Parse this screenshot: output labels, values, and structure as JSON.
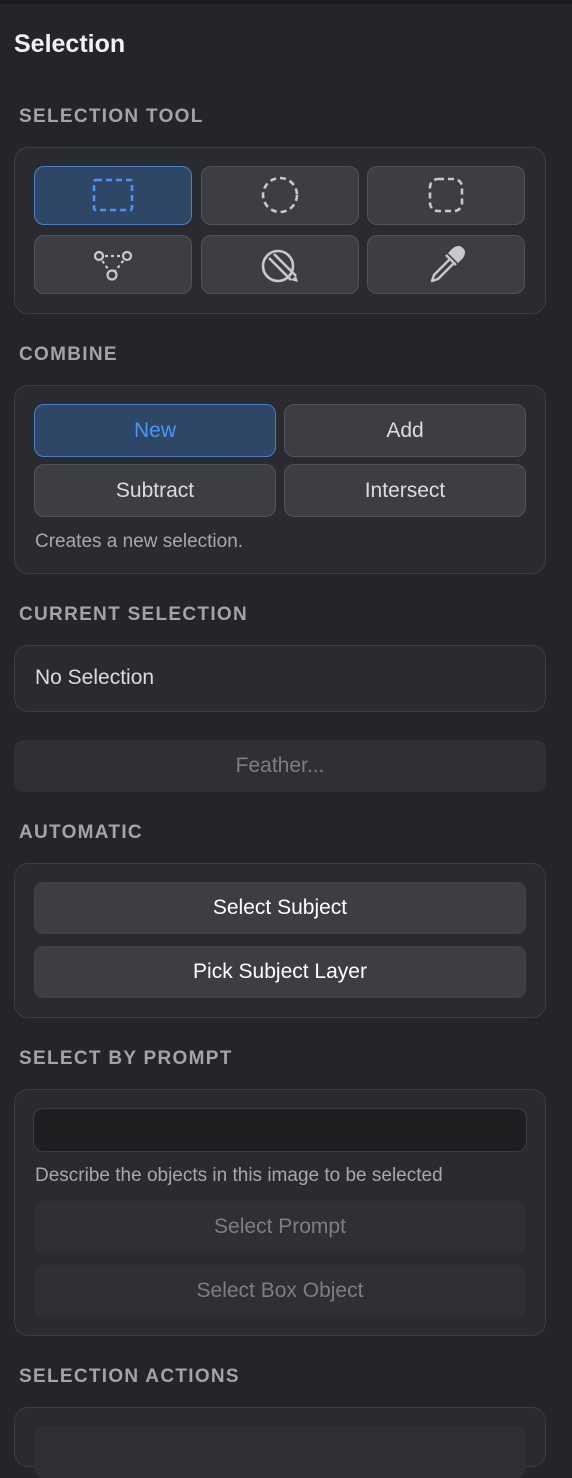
{
  "panel": {
    "title": "Selection"
  },
  "selection_tool": {
    "label": "SELECTION TOOL",
    "tools": [
      {
        "icon": "rectangle-marquee-icon",
        "selected": true
      },
      {
        "icon": "ellipse-marquee-icon",
        "selected": false
      },
      {
        "icon": "rounded-rectangle-marquee-icon",
        "selected": false
      },
      {
        "icon": "polygon-lasso-icon",
        "selected": false
      },
      {
        "icon": "quick-selection-brush-icon",
        "selected": false
      },
      {
        "icon": "eyedropper-icon",
        "selected": false
      }
    ]
  },
  "combine": {
    "label": "COMBINE",
    "new": "New",
    "add": "Add",
    "subtract": "Subtract",
    "intersect": "Intersect",
    "selected": "New",
    "hint": "Creates a new selection."
  },
  "current_selection": {
    "label": "CURRENT SELECTION",
    "value": "No Selection",
    "feather": "Feather..."
  },
  "automatic": {
    "label": "AUTOMATIC",
    "select_subject": "Select Subject",
    "pick_subject_layer": "Pick Subject Layer"
  },
  "select_by_prompt": {
    "label": "SELECT BY PROMPT",
    "input_value": "",
    "hint": "Describe the objects in this image to be selected",
    "select_prompt": "Select Prompt",
    "select_box_object": "Select Box Object"
  },
  "selection_actions": {
    "label": "SELECTION ACTIONS"
  },
  "colors": {
    "background": "#242529",
    "group": "#2a2b30",
    "button": "#3d3e43",
    "accent": "#4d94f0",
    "accent_fill": "#2e4766"
  }
}
